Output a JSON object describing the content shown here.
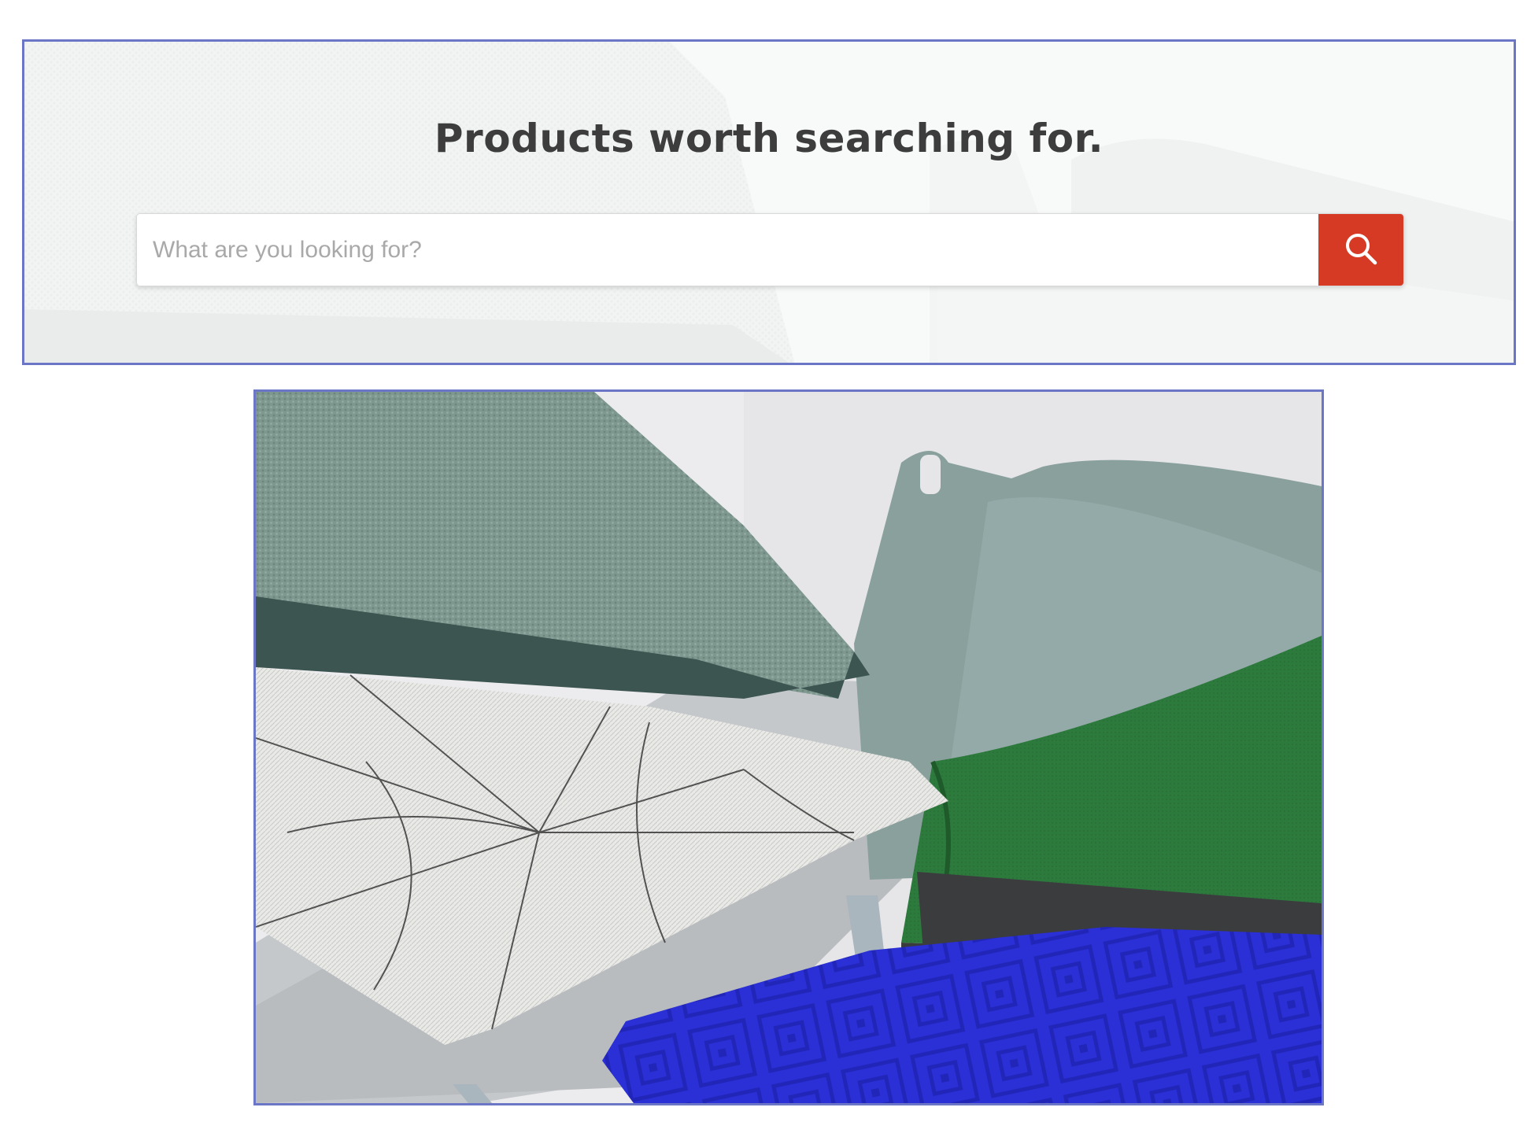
{
  "hero": {
    "title": "Products worth searching for.",
    "search": {
      "placeholder": "What are you looking for?",
      "value": "",
      "button_icon": "search-icon"
    }
  },
  "colors": {
    "search_button": "#d63a24",
    "frame_border": "#6b76c6",
    "title_text": "#3d3d3d",
    "placeholder_text": "#a9a9a9"
  },
  "product_image": {
    "items": [
      "green-pillow",
      "geometric-pattern-pillow",
      "blue-quilted-pillow",
      "grey-felt-basket",
      "green-felt-basket",
      "grey-chair"
    ]
  }
}
